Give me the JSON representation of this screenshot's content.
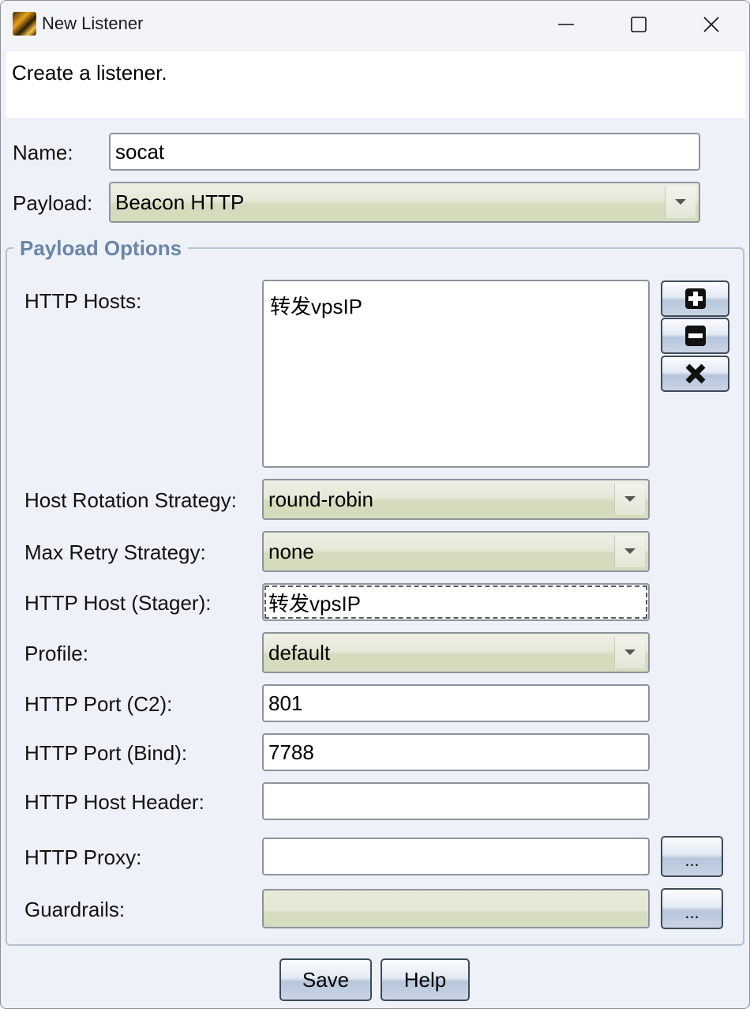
{
  "window": {
    "title": "New Listener",
    "header": "Create a listener."
  },
  "form": {
    "name_label": "Name:",
    "name_value": "socat",
    "payload_label": "Payload:",
    "payload_value": "Beacon HTTP"
  },
  "payload_options": {
    "group_title": "Payload Options",
    "http_hosts_label": "HTTP Hosts:",
    "http_hosts": [
      "转发vpsIP"
    ],
    "rotation_label": "Host Rotation Strategy:",
    "rotation_value": "round-robin",
    "retry_label": "Max Retry Strategy:",
    "retry_value": "none",
    "stager_label": "HTTP Host (Stager):",
    "stager_value": "转发vpsIP",
    "profile_label": "Profile:",
    "profile_value": "default",
    "port_c2_label": "HTTP Port (C2):",
    "port_c2_value": "801",
    "port_bind_label": "HTTP Port (Bind):",
    "port_bind_value": "7788",
    "host_header_label": "HTTP Host Header:",
    "host_header_value": "",
    "proxy_label": "HTTP Proxy:",
    "proxy_value": "",
    "proxy_button": "...",
    "guardrails_label": "Guardrails:",
    "guardrails_button": "..."
  },
  "buttons": {
    "save": "Save",
    "help": "Help"
  }
}
